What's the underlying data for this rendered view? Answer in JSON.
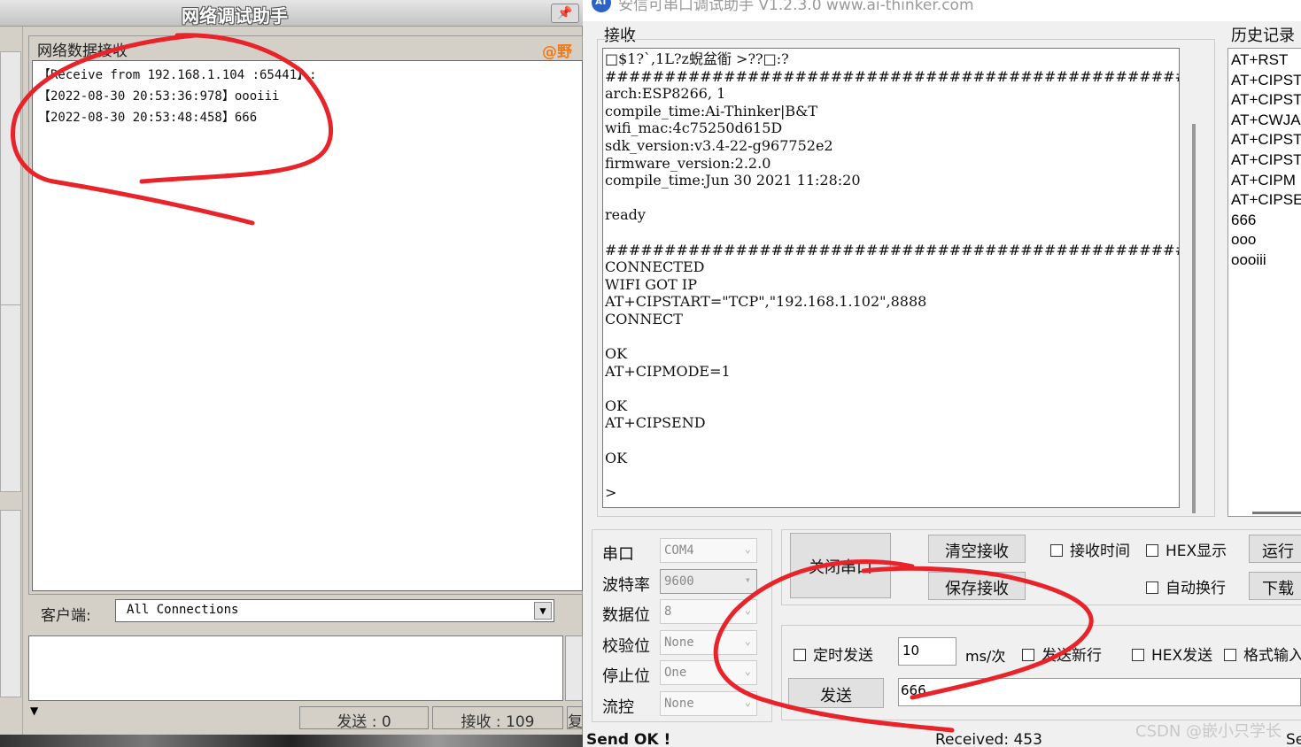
{
  "left_app": {
    "title": "网络调试助手",
    "pin_icon": "pushpin-icon",
    "recv_group_label": "网络数据接收",
    "brand": "@野",
    "recv_lines": [
      "【Receive from 192.168.1.104 :65441】:",
      "【2022-08-30 20:53:36:978】oooiii",
      "【2022-08-30 20:53:48:458】666"
    ],
    "client_label": "客户端:",
    "client_value": "All Connections",
    "status_send": "发送 : 0",
    "status_recv": "接收 : 109",
    "status_extra": "复"
  },
  "right_app": {
    "title": "安信可串口调试助手 V1.2.3.0    www.ai-thinker.com",
    "logo_text": "AT",
    "recv_label": "接收",
    "terminal_lines": [
      "□$1?`,1L?z蜺盆衜 >??□:?",
      "#################################################",
      "arch:ESP8266, 1",
      "compile_time:Ai-Thinker|B&T",
      "wifi_mac:4c75250d615D",
      "sdk_version:v3.4-22-g967752e2",
      "firmware_version:2.2.0",
      "compile_time:Jun 30 2021 11:28:20",
      "",
      "ready",
      "",
      "#################################################WIFI",
      "CONNECTED",
      "WIFI GOT IP",
      "AT+CIPSTART=\"TCP\",\"192.168.1.102\",8888",
      "CONNECT",
      "",
      "OK",
      "AT+CIPMODE=1",
      "",
      "OK",
      "AT+CIPSEND",
      "",
      "OK",
      "",
      ">"
    ],
    "history_label": "历史记录",
    "history_items": [
      "AT+RST",
      "AT+CIPST",
      "AT+CIPST",
      "AT+CWJA",
      "AT+CIPST",
      "AT+CIPST",
      "AT+CIPM",
      "AT+CIPSE",
      "666",
      "ooo",
      "oooiii"
    ],
    "settings": [
      {
        "label": "串口",
        "value": "COM4",
        "active": false
      },
      {
        "label": "波特率",
        "value": "9600",
        "active": true
      },
      {
        "label": "数据位",
        "value": "8",
        "active": false
      },
      {
        "label": "校验位",
        "value": "None",
        "active": false
      },
      {
        "label": "停止位",
        "value": "One",
        "active": false
      },
      {
        "label": "流控",
        "value": "None",
        "active": false
      }
    ],
    "buttons": {
      "close_port": "关闭串口",
      "clear_recv": "清空接收",
      "save_recv": "保存接收",
      "run": "运行",
      "download": "下载",
      "send": "发送"
    },
    "checks": {
      "recv_time": "接收时间",
      "hex_display": "HEX显示",
      "auto_newline": "自动换行",
      "timed_send": "定时发送",
      "send_newline": "发送新行",
      "hex_send": "HEX发送",
      "format_input": "格式输入"
    },
    "interval_value": "10",
    "interval_unit": "ms/次",
    "send_text": "666",
    "status_left": "Send OK !",
    "status_right": "Received: 453",
    "status_far": "Se"
  },
  "watermark": "CSDN @嵌小只学长",
  "annotation_color": "#e8232a"
}
